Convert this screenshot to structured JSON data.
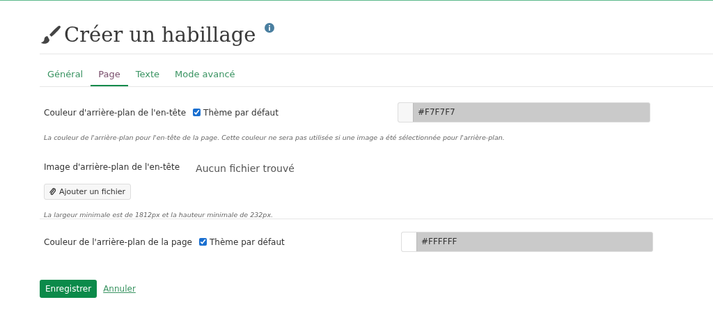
{
  "title": "Créer un habillage",
  "tabs": [
    {
      "label": "Général",
      "selected": false
    },
    {
      "label": "Page",
      "selected": true
    },
    {
      "label": "Texte",
      "selected": false
    },
    {
      "label": "Mode avancé",
      "selected": false
    }
  ],
  "header_color": {
    "label": "Couleur d'arrière-plan de l'en-tête",
    "checkbox_label": "Thème par défaut",
    "checked": true,
    "value": "#F7F7F7",
    "color": "#f7f7f7",
    "disabled": true,
    "help": "La couleur de l'arrière-plan pour l'en-tête de la page. Cette couleur ne sera pas utilisée si une image a été sélectionnée pour l'arrière-plan."
  },
  "header_image": {
    "label": "Image d'arrière-plan de l'en-tête",
    "status": "Aucun fichier trouvé",
    "button": "Ajouter un fichier",
    "help": "La largeur minimale est de 1812px et la hauteur minimale de 232px."
  },
  "page_color": {
    "label": "Couleur de l'arrière-plan de la page",
    "checkbox_label": "Thème par défaut",
    "checked": true,
    "value": "#FFFFFF",
    "color": "#ffffff",
    "disabled": true
  },
  "buttons": {
    "save": "Enregistrer",
    "cancel": "Annuler"
  }
}
